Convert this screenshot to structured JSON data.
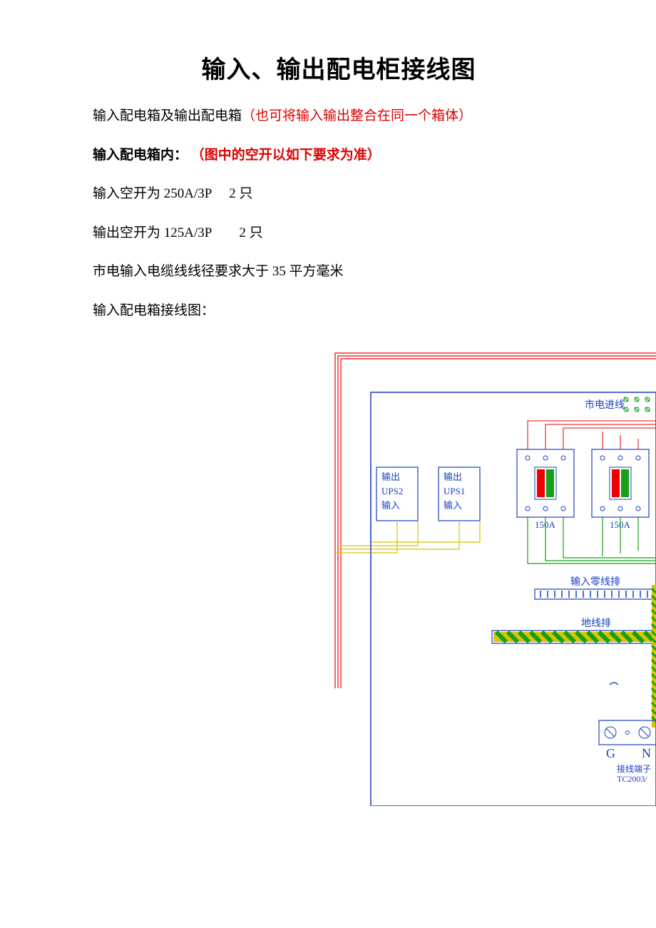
{
  "title": "输入、输出配电柜接线图",
  "intro_black": "输入配电箱及输出配电箱",
  "intro_red": "（也可将输入输出整合在同一个箱体）",
  "section_black": "输入配电箱内：",
  "section_red": "（图中的空开以如下要求为准）",
  "line1a": "输入空开为 250A/3P",
  "line1b": "2 只",
  "line2a": "输出空开为 125A/3P",
  "line2b": "2 只",
  "line3": "市电输入电缆线线径要求大于 35 平方毫米",
  "line4": "输入配电箱接线图：",
  "diagram": {
    "mains_label": "市电进线",
    "ups2_l1": "输出",
    "ups2_l2": "UPS2",
    "ups2_l3": "输入",
    "ups1_l1": "输出",
    "ups1_l2": "UPS1",
    "ups1_l3": "输入",
    "breaker_rating": "150A",
    "neutral_bar": "输入零线排",
    "ground_bar": "地线排",
    "term_G": "G",
    "term_N": "N",
    "term_label1": "接线端子",
    "term_label2": "TC2003/"
  }
}
